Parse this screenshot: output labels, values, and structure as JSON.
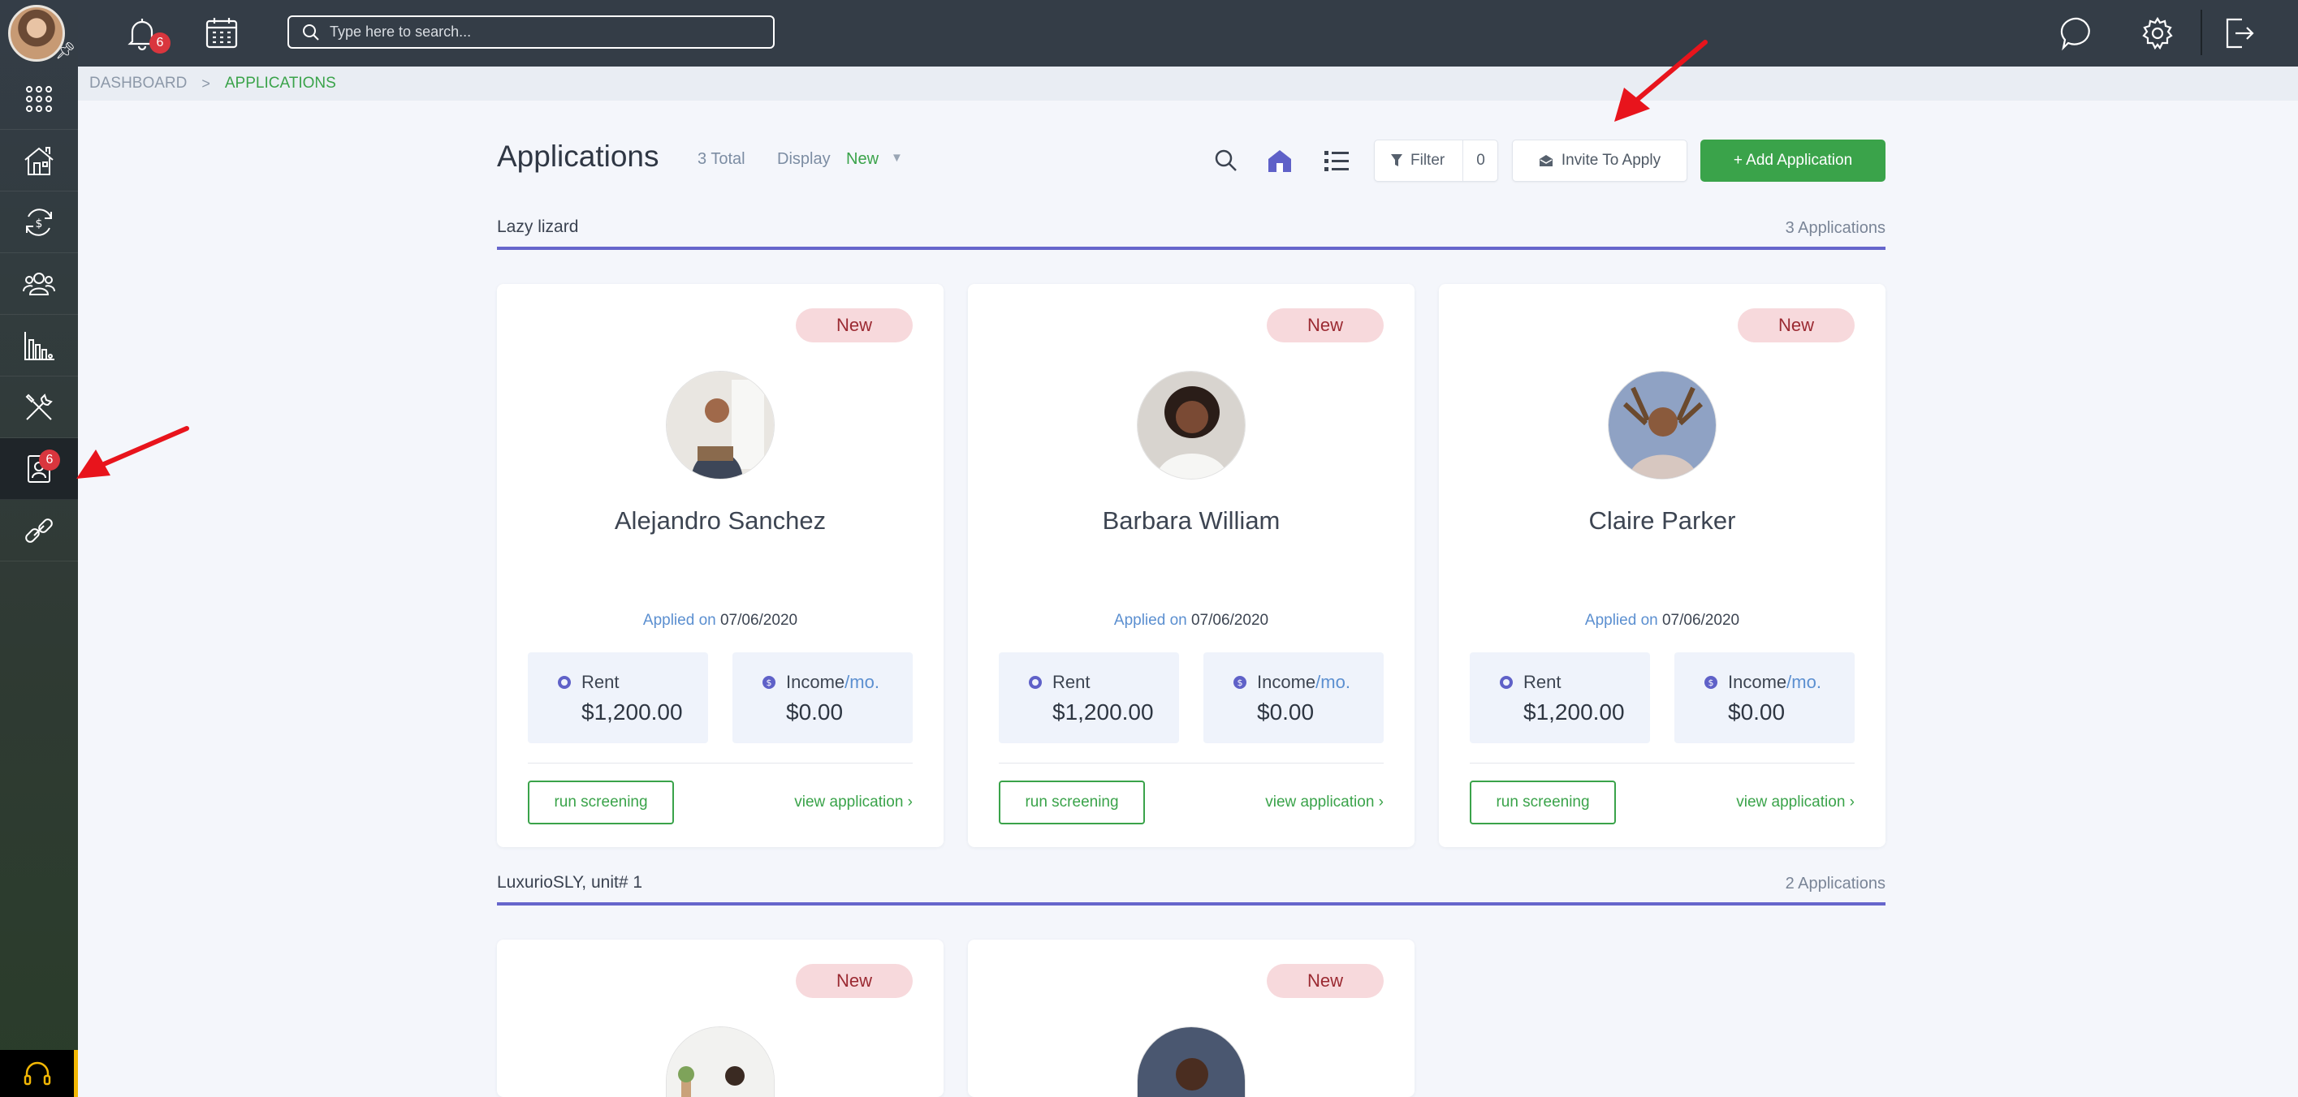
{
  "sidebar": {
    "items": [
      {
        "name": "apps",
        "icon": "grid-icon"
      },
      {
        "name": "properties",
        "icon": "house-icon"
      },
      {
        "name": "payments",
        "icon": "money-cycle-icon"
      },
      {
        "name": "people",
        "icon": "people-icon"
      },
      {
        "name": "reports",
        "icon": "bar-chart-icon"
      },
      {
        "name": "maintenance",
        "icon": "tools-icon"
      },
      {
        "name": "applications",
        "icon": "applicant-icon",
        "badge": "6",
        "active": true
      },
      {
        "name": "links",
        "icon": "link-icon"
      }
    ]
  },
  "topbar": {
    "notifications_badge": "6",
    "search_placeholder": "Type here to search..."
  },
  "breadcrumb": {
    "root": "DASHBOARD",
    "separator": ">",
    "current": "APPLICATIONS"
  },
  "header": {
    "title": "Applications",
    "total": "3 Total",
    "display_label": "Display",
    "display_value": "New",
    "filter_label": "Filter",
    "filter_count": "0",
    "invite_label": "Invite To Apply",
    "add_label": "+ Add Application"
  },
  "groups": [
    {
      "name": "Lazy lizard",
      "count": "3 Applications",
      "applicants": [
        {
          "status": "New",
          "name": "Alejandro Sanchez",
          "applied_label": "Applied on",
          "applied_date": "07/06/2020",
          "rent_label": "Rent",
          "rent": "$1,200.00",
          "income_label": "Income",
          "income_suffix": "/mo.",
          "income": "$0.00",
          "screen_label": "run screening",
          "view_label": "view application ›"
        },
        {
          "status": "New",
          "name": "Barbara William",
          "applied_label": "Applied on",
          "applied_date": "07/06/2020",
          "rent_label": "Rent",
          "rent": "$1,200.00",
          "income_label": "Income",
          "income_suffix": "/mo.",
          "income": "$0.00",
          "screen_label": "run screening",
          "view_label": "view application ›"
        },
        {
          "status": "New",
          "name": "Claire Parker",
          "applied_label": "Applied on",
          "applied_date": "07/06/2020",
          "rent_label": "Rent",
          "rent": "$1,200.00",
          "income_label": "Income",
          "income_suffix": "/mo.",
          "income": "$0.00",
          "screen_label": "run screening",
          "view_label": "view application ›"
        }
      ]
    },
    {
      "name": "LuxurioSLY, unit# 1",
      "count": "2 Applications",
      "applicants": [
        {
          "status": "New"
        },
        {
          "status": "New"
        }
      ]
    }
  ],
  "colors": {
    "accent_green": "#3aa34a",
    "topbar": "#343d47",
    "group_underline": "#6666cc",
    "badge_red": "#d9363e",
    "annotation_arrow": "#e8141c"
  }
}
